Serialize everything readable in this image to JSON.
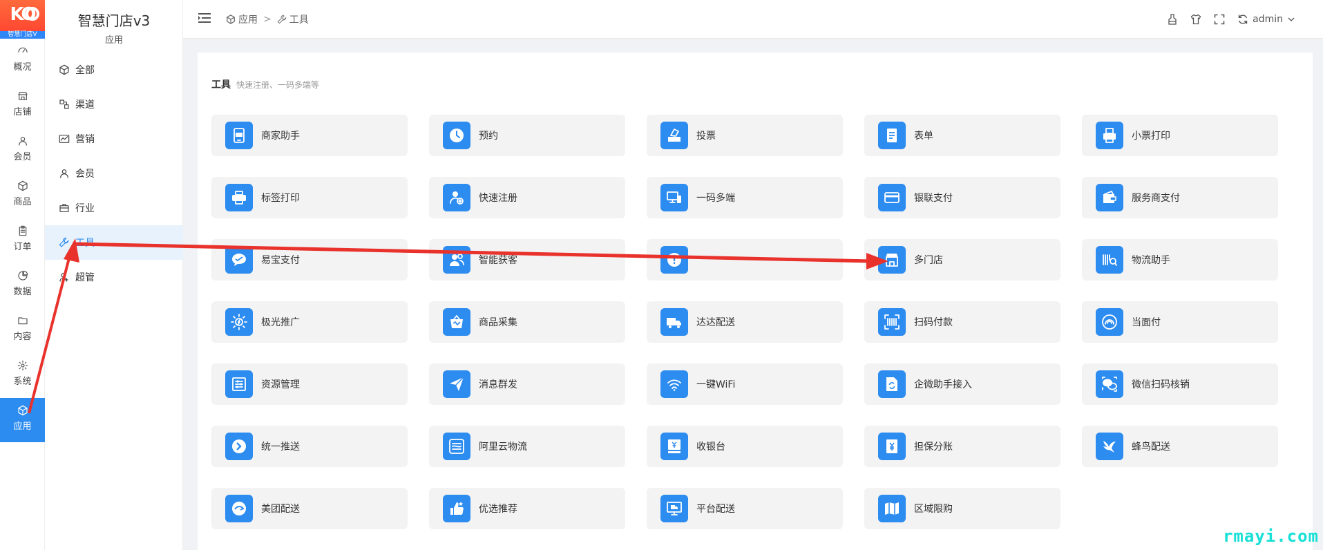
{
  "logo": {
    "mark": "KO",
    "caption": "智慧门店V"
  },
  "rail": {
    "items": [
      {
        "label": "概况",
        "icon": "dashboard-icon"
      },
      {
        "label": "店铺",
        "icon": "shop-icon"
      },
      {
        "label": "会员",
        "icon": "user-icon"
      },
      {
        "label": "商品",
        "icon": "cube-icon"
      },
      {
        "label": "订单",
        "icon": "clipboard-icon"
      },
      {
        "label": "数据",
        "icon": "chart-pie-icon"
      },
      {
        "label": "内容",
        "icon": "folder-icon"
      },
      {
        "label": "系统",
        "icon": "gear-icon"
      },
      {
        "label": "应用",
        "icon": "cube-icon",
        "active": true
      }
    ]
  },
  "sidebar": {
    "title": "智慧门店v3",
    "caption": "应用",
    "items": [
      {
        "label": "全部",
        "icon": "cube-icon"
      },
      {
        "label": "渠道",
        "icon": "channel-icon"
      },
      {
        "label": "营销",
        "icon": "trend-icon"
      },
      {
        "label": "会员",
        "icon": "user-icon"
      },
      {
        "label": "行业",
        "icon": "briefcase-icon"
      },
      {
        "label": "工具",
        "icon": "wrench-icon",
        "active": true
      },
      {
        "label": "超管",
        "icon": "admin-icon"
      }
    ]
  },
  "header": {
    "breadcrumb": {
      "root": "应用",
      "separator": ">",
      "current": "工具"
    },
    "user": "admin",
    "icons": [
      "clean-icon",
      "shirt-icon",
      "fullscreen-icon",
      "refresh-icon"
    ]
  },
  "main": {
    "section_title": "工具",
    "section_subtitle": "快速注册、一码多端等",
    "tiles": [
      {
        "label": "商家助手",
        "icon": "app-icon"
      },
      {
        "label": "预约",
        "icon": "clock-icon"
      },
      {
        "label": "投票",
        "icon": "vote-icon"
      },
      {
        "label": "表单",
        "icon": "form-icon"
      },
      {
        "label": "小票打印",
        "icon": "receipt-printer-icon"
      },
      {
        "label": "标签打印",
        "icon": "printer-icon"
      },
      {
        "label": "快速注册",
        "icon": "register-icon"
      },
      {
        "label": "一码多端",
        "icon": "devices-icon"
      },
      {
        "label": "银联支付",
        "icon": "card-icon"
      },
      {
        "label": "服务商支付",
        "icon": "wallet-icon"
      },
      {
        "label": "易宝支付",
        "icon": "chat-icon"
      },
      {
        "label": "智能获客",
        "icon": "people-icon"
      },
      {
        "label": "",
        "icon": "alert-icon"
      },
      {
        "label": "多门店",
        "icon": "store-icon"
      },
      {
        "label": "物流助手",
        "icon": "barcode-search-icon"
      },
      {
        "label": "极光推广",
        "icon": "sun-icon"
      },
      {
        "label": "商品采集",
        "icon": "basket-icon"
      },
      {
        "label": "达达配送",
        "icon": "truck-icon"
      },
      {
        "label": "扫码付款",
        "icon": "scan-icon"
      },
      {
        "label": "当面付",
        "icon": "contactless-icon"
      },
      {
        "label": "资源管理",
        "icon": "sliders-icon"
      },
      {
        "label": "消息群发",
        "icon": "send-icon"
      },
      {
        "label": "一键WiFi",
        "icon": "wifi-icon"
      },
      {
        "label": "企微助手接入",
        "icon": "sync-file-icon"
      },
      {
        "label": "微信扫码核销",
        "icon": "wechat-icon"
      },
      {
        "label": "统一推送",
        "icon": "arrow-circle-icon"
      },
      {
        "label": "阿里云物流",
        "icon": "aliyun-icon"
      },
      {
        "label": "收银台",
        "icon": "cashier-icon"
      },
      {
        "label": "担保分账",
        "icon": "yen-doc-icon"
      },
      {
        "label": "蜂鸟配送",
        "icon": "bird-icon"
      },
      {
        "label": "美团配送",
        "icon": "meituan-icon"
      },
      {
        "label": "优选推荐",
        "icon": "thumbs-up-icon"
      },
      {
        "label": "平台配送",
        "icon": "monitor-delivery-icon"
      },
      {
        "label": "区域限购",
        "icon": "map-icon"
      }
    ]
  },
  "watermark": "rmayi.com",
  "colors": {
    "accent": "#2d8cf0",
    "annotation": "#e8322b",
    "watermark": "#18e0d6"
  }
}
